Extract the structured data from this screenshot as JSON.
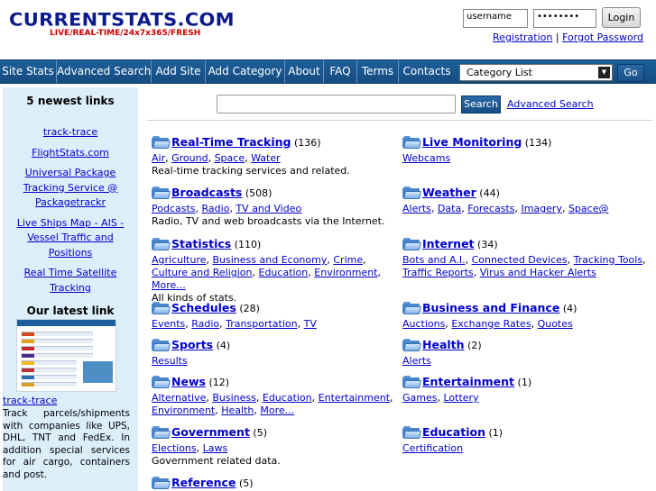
{
  "header": {
    "logo": "CURRENTSTATS.COM",
    "tagline": "LIVE/REAL-TIME/24x7x365/FRESH",
    "username_value": "username",
    "password_value": "••••••••",
    "login_label": "Login",
    "registration_link": "Registration",
    "separator": "|",
    "forgot_password_link": "Forgot Password"
  },
  "nav": {
    "items": [
      "Site Stats",
      "Advanced Search",
      "Add Site",
      "Add Category",
      "About",
      "FAQ",
      "Terms",
      "Contacts"
    ],
    "category_select": "Category List",
    "go_label": "Go"
  },
  "sidebar": {
    "newest_heading": "5 newest links",
    "newest_links": [
      "track-trace",
      "FlightStats.com",
      "Universal Package Tracking Service @ Packagetrackr",
      "Live Ships Map - AIS - Vessel Traffic and Positions",
      "Real Time Satellite Tracking"
    ],
    "latest_heading": "Our latest link",
    "latest_link": "track-trace",
    "latest_description": "Track parcels/shipments with companies like UPS, DHL, TNT and FedEx. In addition special services for air cargo, containers and post."
  },
  "search": {
    "input_value": "",
    "button_label": "Search",
    "advanced_link": "Advanced Search"
  },
  "categories": {
    "left": [
      {
        "title": "Real-Time Tracking",
        "count": "(136)",
        "subs": [
          "Air",
          "Ground",
          "Space",
          "Water"
        ],
        "desc": "Real-time tracking services and related."
      },
      {
        "title": "Broadcasts",
        "count": "(508)",
        "subs": [
          "Podcasts",
          "Radio",
          "TV and Video"
        ],
        "desc": "Radio, TV and web broadcasts via the Internet."
      },
      {
        "title": "Statistics",
        "count": "(110)",
        "subs": [
          "Agriculture",
          "Business and Economy",
          "Crime",
          "Culture and Religion",
          "Education",
          "Environment",
          "More..."
        ],
        "desc": "All kinds of stats."
      },
      {
        "title": "Schedules",
        "count": "(28)",
        "subs": [
          "Events",
          "Radio",
          "Transportation",
          "TV"
        ],
        "desc": ""
      },
      {
        "title": "Sports",
        "count": "(4)",
        "subs": [
          "Results"
        ],
        "desc": ""
      },
      {
        "title": "News",
        "count": "(12)",
        "subs": [
          "Alternative",
          "Business",
          "Education",
          "Entertainment",
          "Environment",
          "Health",
          "More..."
        ],
        "desc": ""
      },
      {
        "title": "Government",
        "count": "(5)",
        "subs": [
          "Elections",
          "Laws"
        ],
        "desc": "Government related data."
      },
      {
        "title": "Reference",
        "count": "(5)",
        "subs": [],
        "desc": ""
      }
    ],
    "right": [
      {
        "title": "Live Monitoring",
        "count": "(134)",
        "subs": [
          "Webcams"
        ],
        "desc": ""
      },
      {
        "title": "Weather",
        "count": "(44)",
        "subs": [
          "Alerts",
          "Data",
          "Forecasts",
          "Imagery",
          "Space@"
        ],
        "desc": ""
      },
      {
        "title": "Internet",
        "count": "(34)",
        "subs": [
          "Bots and A.I.",
          "Connected Devices",
          "Tracking Tools",
          "Traffic Reports",
          "Virus and Hacker Alerts"
        ],
        "desc": ""
      },
      {
        "title": "Business and Finance",
        "count": "(4)",
        "subs": [
          "Auctions",
          "Exchange Rates",
          "Quotes"
        ],
        "desc": ""
      },
      {
        "title": "Health",
        "count": "(2)",
        "subs": [
          "Alerts"
        ],
        "desc": ""
      },
      {
        "title": "Entertainment",
        "count": "(1)",
        "subs": [
          "Games",
          "Lottery"
        ],
        "desc": ""
      },
      {
        "title": "Education",
        "count": "(1)",
        "subs": [
          "Certification"
        ],
        "desc": ""
      }
    ]
  },
  "colors": {
    "nav_bg": "#1d5f9a",
    "sidebar_bg": "#ddeefb",
    "logo": "#0a1a8a",
    "tagline": "#cc0000",
    "link": "#0000cc"
  }
}
